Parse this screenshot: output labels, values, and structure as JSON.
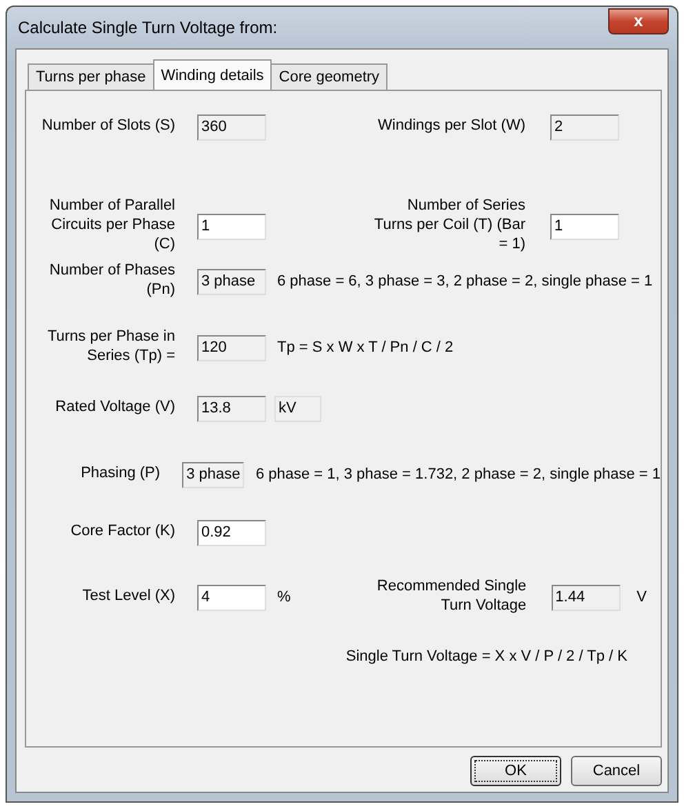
{
  "window": {
    "title": "Calculate Single Turn Voltage from:",
    "close": "x"
  },
  "tabs": [
    {
      "label": "Turns per phase",
      "selected": false
    },
    {
      "label": "Winding details",
      "selected": true
    },
    {
      "label": "Core geometry",
      "selected": false
    }
  ],
  "rows": [
    {
      "label": "Number of  Slots (S)",
      "value": "360",
      "readonly": true,
      "right": {
        "label": "Windings per Slot (W)",
        "value": "2",
        "readonly": true
      }
    },
    {
      "label": "Number of Parallel Circuits per Phase (C)",
      "value": "1",
      "readonly": false,
      "right": {
        "label": "Number of Series Turns per Coil (T) (Bar = 1)",
        "value": "1",
        "readonly": false
      }
    },
    {
      "label": "Number of Phases (Pn)",
      "value": "3 phase",
      "readonly": true,
      "note": "6 phase = 6, 3 phase = 3, 2 phase = 2, single phase = 1"
    },
    {
      "label": "Turns per Phase in Series (Tp) =",
      "value": "120",
      "readonly": true,
      "note": "Tp = S x W x T / Pn / C / 2"
    },
    {
      "label": "Rated Voltage (V)",
      "value": "13.8",
      "readonly": true,
      "unit_box": "kV"
    },
    {
      "label": "Phasing (P)",
      "value": "3 phase",
      "readonly": true,
      "note": "6 phase = 1, 3 phase = 1.732, 2 phase = 2, single phase = 1"
    },
    {
      "label": "Core Factor (K)",
      "value": "0.92",
      "readonly": false
    },
    {
      "label": "Test Level (X)",
      "value": "4",
      "readonly": false,
      "unit": "%",
      "right": {
        "label": "Recommended Single Turn Voltage",
        "value": "1.44",
        "readonly": true,
        "unit": "V"
      }
    }
  ],
  "formula": "Single Turn Voltage = X x V / P / 2 / Tp / K",
  "buttons": [
    {
      "label": "OK",
      "default": true
    },
    {
      "label": "Cancel",
      "default": false
    }
  ]
}
